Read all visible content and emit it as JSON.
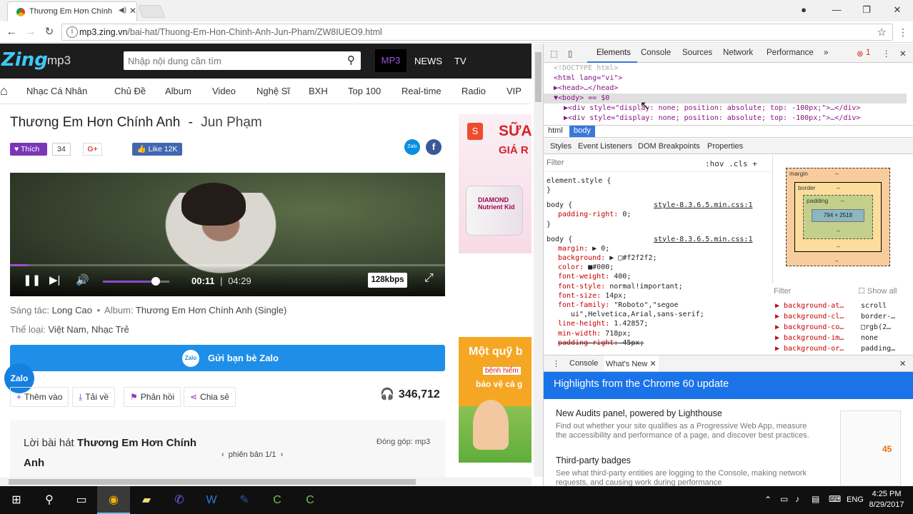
{
  "browser": {
    "tab_title": "Thương Em Hơn Chính",
    "url_host": "mp3.zing.vn",
    "url_path": "/bai-hat/Thuong-Em-Hon-Chinh-Anh-Jun-Pham/ZW8IUEO9.html",
    "info_icon": "i"
  },
  "zing": {
    "logo_main": "Zing",
    "logo_sub": "mp3",
    "search_placeholder": "Nhập nội dung cần tìm",
    "top_links": [
      "MP3",
      "NEWS",
      "TV"
    ],
    "nav": [
      "Nhạc Cá Nhân",
      "Chủ Đề",
      "Album",
      "Video",
      "Nghệ Sĩ",
      "BXH",
      "Top 100",
      "Real-time",
      "Radio",
      "VIP"
    ],
    "song_title": "Thương Em Hơn Chính Anh",
    "separator": "-",
    "artist": "Jun Phạm",
    "like_label": "Thích",
    "like_count": "34",
    "gplus": "G+",
    "fb_like": "Like 12K",
    "zalo_small": "Zalo",
    "fb_letter": "f",
    "player": {
      "progress_fraction": 0.043,
      "volume_fraction": 0.8,
      "current_time": "00:11",
      "divider": "|",
      "total_time": "04:29",
      "bitrate": "128kbps"
    },
    "composer_label": "Sáng tác:",
    "composer": "Long Cao",
    "album_label": "Album:",
    "album": "Thương Em Hơn Chính Anh (Single)",
    "genre_label": "Thể loại:",
    "genres": "Việt Nam, Nhạc Trẻ",
    "zalo_share": "Gửi bạn bè Zalo",
    "zalo_float": "Zalo",
    "actions": [
      "Thêm vào",
      "Tải về",
      "Phản hồi",
      "Chia sẻ"
    ],
    "play_count": "346,712",
    "lyrics_prefix": "Lời bài hát",
    "lyrics_title": "Thương Em Hơn Chính Anh",
    "version": "phiên bản 1/1",
    "contributor": "Đóng góp: mp3"
  },
  "ads": {
    "ad1_line1": "SỮA",
    "ad1_line2": "GIÁ R",
    "ad1_product": "DIAMOND Nutrient Kid",
    "ad1_brand": "S",
    "ad2_line1": "Một quỹ b",
    "ad2_line2": "bệnh hiểm",
    "ad2_line3": "bảo vệ cả g"
  },
  "devtools": {
    "tabs": [
      "Elements",
      "Console",
      "Sources",
      "Network",
      "Performance"
    ],
    "more": "»",
    "error_count": "1",
    "dom_lines": [
      "<!DOCTYPE html>",
      "<html lang=\"vi\">",
      "▶<head>…</head>",
      "▼<body> == $0",
      "▶<div style=\"display: none; position: absolute; top: -100px;\">…</div>",
      "▶<div style=\"display: none; position: absolute; top: -100px;\">…</div>"
    ],
    "crumbs": [
      "html",
      "body"
    ],
    "style_tabs": [
      "Styles",
      "Event Listeners",
      "DOM Breakpoints",
      "Properties"
    ],
    "filter_placeholder": "Filter",
    "hov_cls": ":hov  .cls  +",
    "rules": [
      {
        "text": "element.style {",
        "src": ""
      },
      {
        "text": "}",
        "src": ""
      },
      {
        "text": "body {",
        "src": "style-8.3.6.5.min.css:1"
      },
      {
        "text": "padding-right: 0;",
        "src": "",
        "prop": true
      },
      {
        "text": "}",
        "src": ""
      },
      {
        "text": "body {",
        "src": "style-8.3.6.5.min.css:1"
      },
      {
        "text": "margin: ▶ 0;",
        "src": "",
        "prop": true
      },
      {
        "text": "background: ▶ □#f2f2f2;",
        "src": "",
        "prop": true
      },
      {
        "text": "color: ■#000;",
        "src": "",
        "prop": true
      },
      {
        "text": "font-weight: 400;",
        "src": "",
        "prop": true
      },
      {
        "text": "font-style: normal!important;",
        "src": "",
        "prop": true
      },
      {
        "text": "font-size: 14px;",
        "src": "",
        "prop": true
      },
      {
        "text": "font-family: \"Roboto\",\"segoe",
        "src": "",
        "prop": true
      },
      {
        "text": "ui\",Helvetica,Arial,sans-serif;",
        "src": "",
        "prop": false
      },
      {
        "text": "line-height: 1.42857;",
        "src": "",
        "prop": true
      },
      {
        "text": "min-width: 718px;",
        "src": "",
        "prop": true
      },
      {
        "text": "padding-right: 45px;",
        "src": "",
        "prop": true
      }
    ],
    "box": {
      "margin": "margin",
      "border": "border",
      "padding": "padding",
      "content": "794 × 2518",
      "dash": "–"
    },
    "computed_filter": "Filter",
    "show_all": "Show all",
    "computed": [
      {
        "p": "background-at…",
        "v": "scroll"
      },
      {
        "p": "background-cl…",
        "v": "border-…"
      },
      {
        "p": "background-co…",
        "v": "□rgb(2…"
      },
      {
        "p": "background-im…",
        "v": "none"
      },
      {
        "p": "background-or…",
        "v": "padding…"
      }
    ],
    "drawer_tabs": [
      "Console",
      "What's New"
    ],
    "whats_new_heading": "Highlights from the Chrome 60 update",
    "items": [
      {
        "title": "New Audits panel, powered by Lighthouse",
        "desc": "Find out whether your site qualifies as a Progressive Web App, measure the accessibility and performance of a page, and discover best practices."
      },
      {
        "title": "Third-party badges",
        "desc": "See what third-party entities are logging to the Console, making network requests, and causing work during performance"
      }
    ],
    "thumb_score": "45"
  },
  "taskbar": {
    "lang": "ENG",
    "time": "4:25 PM",
    "date": "8/29/2017"
  }
}
